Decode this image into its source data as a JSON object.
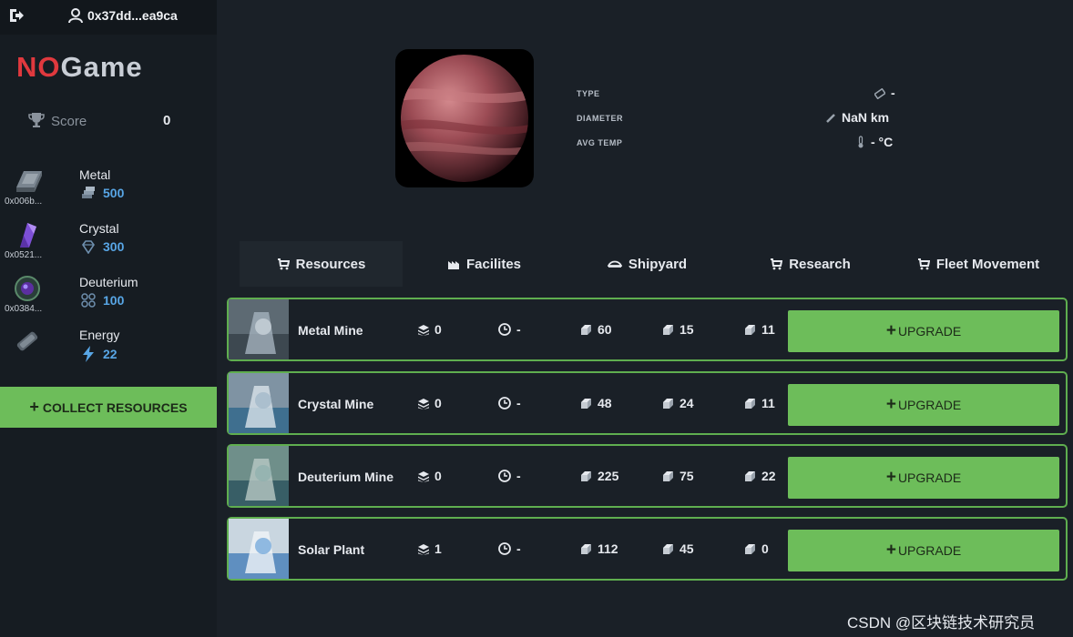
{
  "header": {
    "wallet": "0x37dd...ea9ca"
  },
  "logo": {
    "part1": "NO",
    "part2": "Game"
  },
  "score": {
    "label": "Score",
    "value": "0"
  },
  "resources": [
    {
      "name": "Metal",
      "amount": "500",
      "address": "0x006b..."
    },
    {
      "name": "Crystal",
      "amount": "300",
      "address": "0x0521..."
    },
    {
      "name": "Deuterium",
      "amount": "100",
      "address": "0x0384..."
    },
    {
      "name": "Energy",
      "amount": "22",
      "address": ""
    }
  ],
  "collect_label": "COLLECT RESOURCES",
  "planet": {
    "type_label": "TYPE",
    "type_value": "-",
    "diameter_label": "DIAMETER",
    "diameter_value": "NaN km",
    "temp_label": "AVG TEMP",
    "temp_value": "- °C"
  },
  "tabs": [
    {
      "label": "Resources",
      "active": true
    },
    {
      "label": "Facilites",
      "active": false
    },
    {
      "label": "Shipyard",
      "active": false
    },
    {
      "label": "Research",
      "active": false
    },
    {
      "label": "Fleet Movement",
      "active": false
    }
  ],
  "buildings": [
    {
      "name": "Metal Mine",
      "level": "0",
      "time": "-",
      "cost_metal": "60",
      "cost_crystal": "15",
      "cost_deuterium": "11",
      "upgrade_label": "UPGRADE"
    },
    {
      "name": "Crystal Mine",
      "level": "0",
      "time": "-",
      "cost_metal": "48",
      "cost_crystal": "24",
      "cost_deuterium": "11",
      "upgrade_label": "UPGRADE"
    },
    {
      "name": "Deuterium Mine",
      "level": "0",
      "time": "-",
      "cost_metal": "225",
      "cost_crystal": "75",
      "cost_deuterium": "22",
      "upgrade_label": "UPGRADE"
    },
    {
      "name": "Solar Plant",
      "level": "1",
      "time": "-",
      "cost_metal": "112",
      "cost_crystal": "45",
      "cost_deuterium": "0",
      "upgrade_label": "UPGRADE"
    }
  ],
  "watermark": "CSDN @区块链技术研究员",
  "colors": {
    "accent_green": "#6dbd5a",
    "row_border": "#5fae4f",
    "logo_red": "#e0393e",
    "amount_blue": "#58a6e6"
  },
  "icons": {
    "logout": "logout-icon",
    "wallet": "user-icon",
    "score": "trophy-icon",
    "metal_amount": "stack-icon",
    "crystal_amount": "diamond-icon",
    "deuterium_amount": "molecule-icon",
    "energy_amount": "bolt-icon",
    "tab": "cart-icon",
    "level": "layers-icon",
    "time": "clock-icon",
    "cost": "cube-icon"
  }
}
